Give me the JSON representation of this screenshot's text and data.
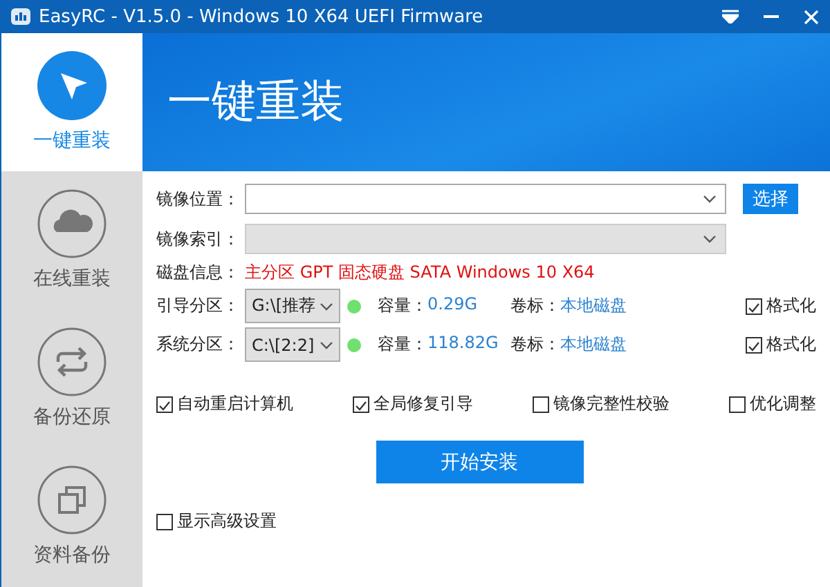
{
  "window": {
    "title": "EasyRC - V1.5.0 - Windows 10 X64 UEFI Firmware"
  },
  "sidebar": {
    "items": [
      {
        "label": "一键重装",
        "kind": "pointer",
        "selected": true
      },
      {
        "label": "在线重装",
        "kind": "cloud",
        "selected": false
      },
      {
        "label": "备份还原",
        "kind": "sync",
        "selected": false
      },
      {
        "label": "资料备份",
        "kind": "copy",
        "selected": false
      }
    ]
  },
  "header": {
    "title": "一键重装"
  },
  "form": {
    "image_location": {
      "label": "镜像位置：",
      "button": "选择"
    },
    "image_index": {
      "label": "镜像索引：",
      "disabled": true
    },
    "disk_info": {
      "label": "磁盘信息：",
      "value": "主分区 GPT 固态硬盘 SATA Windows 10 X64"
    },
    "partitions": [
      {
        "label": "引导分区：",
        "value": "G:\\[推荐",
        "capacity_label": "容量：",
        "capacity": "0.29G",
        "volume_label": "卷标：",
        "volume": "本地磁盘",
        "format": {
          "label": "格式化",
          "checked": true
        }
      },
      {
        "label": "系统分区：",
        "value": "C:\\[2:2]",
        "capacity_label": "容量：",
        "capacity": "118.82G",
        "volume_label": "卷标：",
        "volume": "本地磁盘",
        "format": {
          "label": "格式化",
          "checked": true
        }
      }
    ],
    "options": [
      {
        "label": "自动重启计算机",
        "checked": true
      },
      {
        "label": "全局修复引导",
        "checked": true
      },
      {
        "label": "镜像完整性校验",
        "checked": false
      },
      {
        "label": "优化调整",
        "checked": false
      }
    ],
    "install_button": "开始安装",
    "advanced": {
      "label": "显示高级设置",
      "checked": false
    }
  }
}
